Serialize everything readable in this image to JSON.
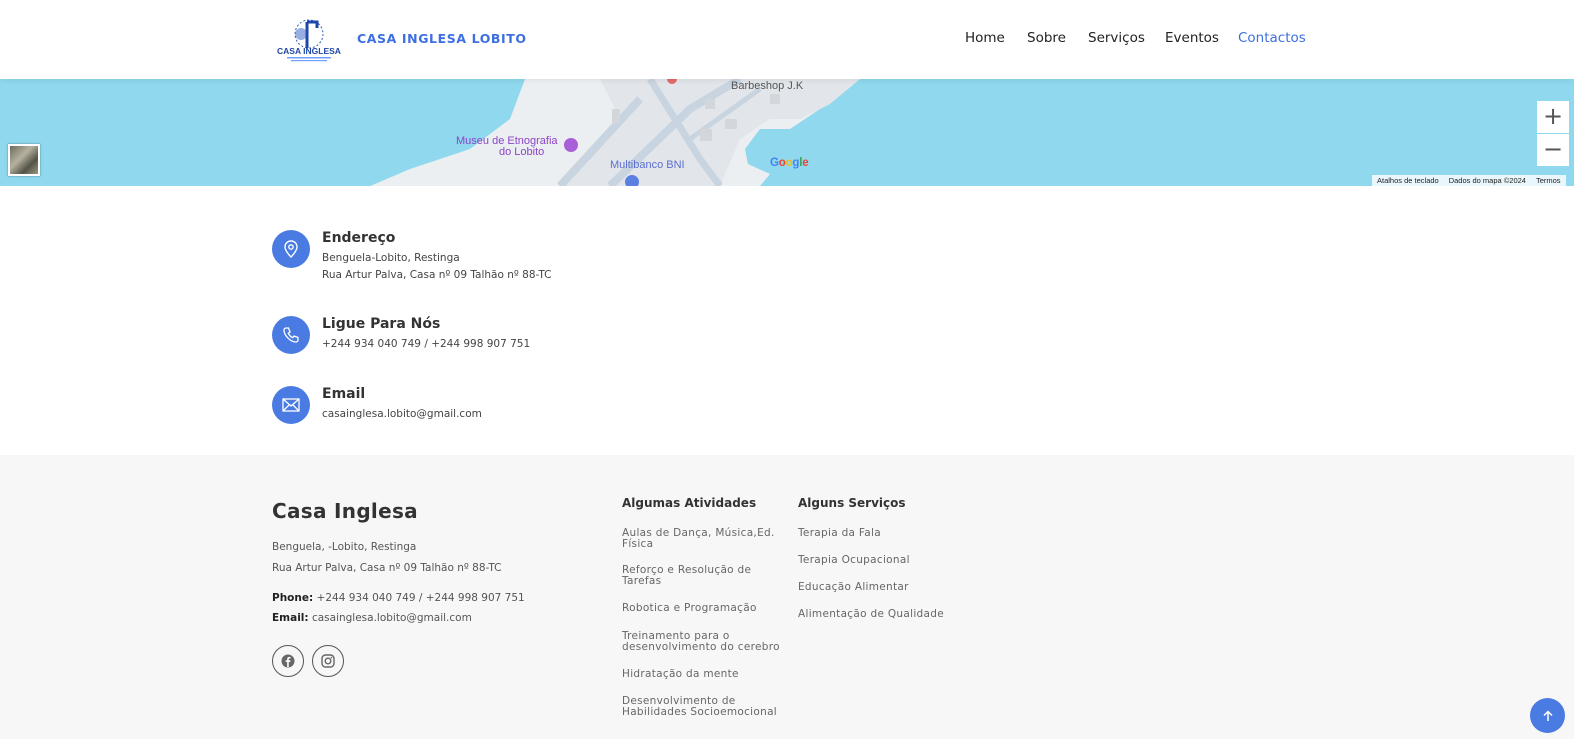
{
  "header": {
    "logo_text": "CASA INGLESA",
    "brand": "CASA INGLESA LOBITO",
    "nav": [
      {
        "label": "Home"
      },
      {
        "label": "Sobre"
      },
      {
        "label": "Serviços"
      },
      {
        "label": "Eventos"
      },
      {
        "label": "Contactos",
        "active": true
      }
    ]
  },
  "map": {
    "labels": {
      "barbershop": "Barbeshop J.K",
      "museum_1": "Museu de Etnografia",
      "museum_2": "do Lobito",
      "multibanco": "Multibanco BNI",
      "google": "Google"
    },
    "zoom_in": "+",
    "zoom_out": "−",
    "footer": {
      "shortcuts": "Atalhos de teclado",
      "data": "Dados do mapa ©2024",
      "terms": "Termos"
    }
  },
  "contact": {
    "address": {
      "title": "Endereço",
      "line1": "Benguela-Lobito, Restinga",
      "line2": "Rua Artur Palva, Casa nº 09 Talhão nº 88-TC"
    },
    "phone": {
      "title": "Ligue Para Nós",
      "line1": "+244 934 040 749 / +244 998 907 751"
    },
    "email": {
      "title": "Email",
      "line1": "casainglesa.lobito@gmail.com"
    }
  },
  "footer": {
    "title": "Casa Inglesa",
    "address1": "Benguela, -Lobito, Restinga",
    "address2": "Rua Artur Palva, Casa nº 09 Talhão nº 88-TC",
    "phone_label": "Phone:",
    "phone": "+244 934 040 749 / +244 998 907 751",
    "email_label": "Email:",
    "email": "casainglesa.lobito@gmail.com",
    "activities": {
      "title": "Algumas Atividades",
      "items": [
        "Aulas de Dança, Música,Ed. Física",
        "Reforço e Resolução de Tarefas",
        "Robotica e Programação",
        "Treinamento para o desenvolvimento do cerebro",
        "Hidratação da mente",
        "Desenvolvimento de Habilidades Socioemocional"
      ]
    },
    "services": {
      "title": "Alguns Serviços",
      "items": [
        "Terapia da Fala",
        "Terapia Ocupacional",
        "Educação Alimentar",
        "Alimentação de Qualidade"
      ]
    }
  },
  "colors": {
    "accent": "#4a7be3",
    "water": "#8fd8ed",
    "footer_bg": "#f7f7f7"
  }
}
